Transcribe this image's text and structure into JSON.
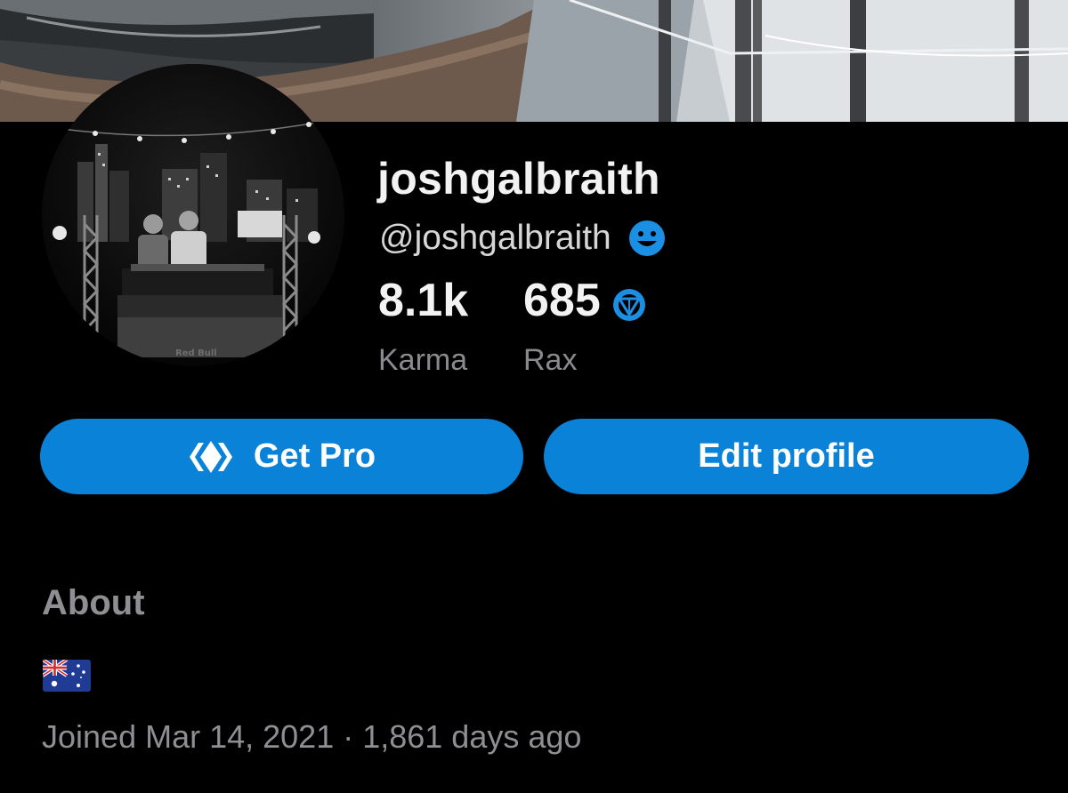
{
  "profile": {
    "display_name": "joshgalbraith",
    "handle": "@joshgalbraith",
    "handle_badge_icon": "smile-face-icon",
    "avatar_text": "Red Bull"
  },
  "stats": {
    "karma_value": "8.1k",
    "karma_label": "Karma",
    "rax_value": "685",
    "rax_label": "Rax",
    "rax_icon": "rax-icon"
  },
  "actions": {
    "get_pro_label": "Get Pro",
    "get_pro_icon": "pro-diamond-icon",
    "edit_profile_label": "Edit profile"
  },
  "about": {
    "title": "About",
    "flag_icon": "australia-flag-icon",
    "joined_text": "Joined Mar 14, 2021 · 1,861 days ago"
  },
  "colors": {
    "background": "#000000",
    "accent": "#0A82D8",
    "secondary_text": "#8E8E93",
    "primary_text": "#F2F2F2"
  }
}
